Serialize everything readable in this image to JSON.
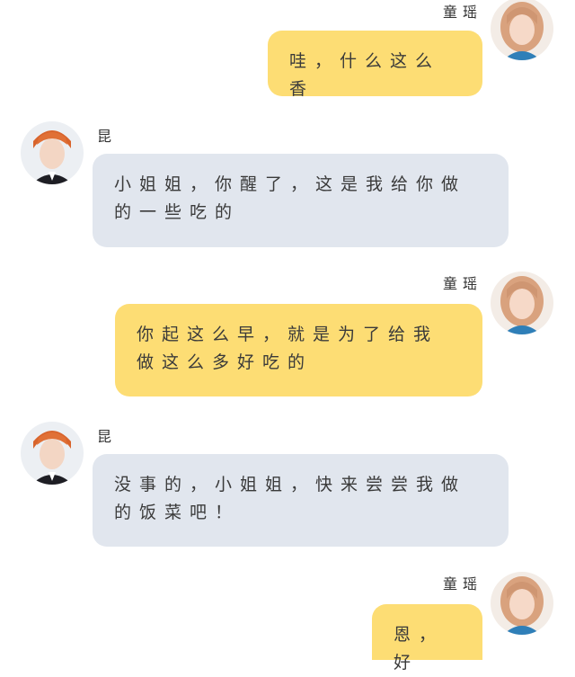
{
  "colors": {
    "page_background": "#ffffff",
    "my_bubble": "#fddd74",
    "their_bubble": "#e1e6ee",
    "text": "#3a3a3a"
  },
  "chat": {
    "messages": [
      {
        "sender": "童瑶",
        "side": "right",
        "avatar_icon": "girl-avatar-icon",
        "text": "哇，什么这么香"
      },
      {
        "sender": "昆",
        "side": "left",
        "avatar_icon": "boy-avatar-icon",
        "text": "小姐姐，你醒了，这是我给你做的一些吃的"
      },
      {
        "sender": "童瑶",
        "side": "right",
        "avatar_icon": "girl-avatar-icon",
        "text": "你起这么早，就是为了给我做这么多好吃的"
      },
      {
        "sender": "昆",
        "side": "left",
        "avatar_icon": "boy-avatar-icon",
        "text": "没事的，小姐姐，快来尝尝我做的饭菜吧！"
      },
      {
        "sender": "童瑶",
        "side": "right",
        "avatar_icon": "girl-avatar-icon",
        "text": "恩，好"
      }
    ]
  }
}
